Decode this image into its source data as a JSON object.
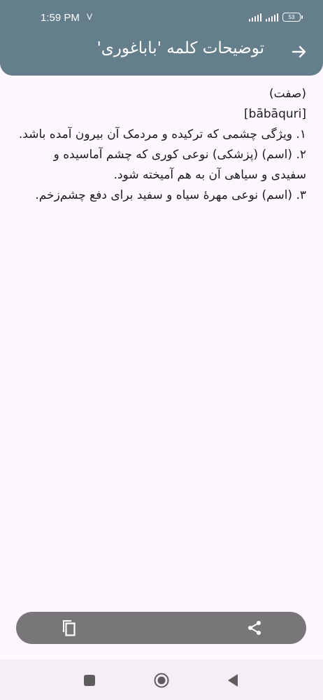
{
  "status_bar": {
    "time": "1:59 PM",
    "indicator": "V",
    "battery": "53",
    "icons": [
      "signal-icon",
      "signal-icon",
      "battery-icon"
    ]
  },
  "header": {
    "title": "توضیحات کلمه 'باباغوری'",
    "back_icon": "arrow-right-icon",
    "background": "#657e8b"
  },
  "definition": {
    "part_of_speech": "(صفت)",
    "pronunciation": "[bābāquri]",
    "senses": [
      "۱. ویژگی چشمی که ترکیده و مردمک آن بیرون آمده باشد.",
      "۲. (اسم) (پزشکی) نوعی کوری که چشم آماسیده و سفیدی و سیاهی آن به هم آمیخته شود.",
      "۳. (اسم) نوعی مهرهٔ سیاه و سفید برای دفع چشم‌زخم."
    ]
  },
  "action_bar": {
    "copy_icon": "copy-icon",
    "share_icon": "share-icon",
    "background": "#79767a"
  },
  "nav_bar": {
    "icons": [
      "recents-square-icon",
      "home-circle-icon",
      "back-triangle-icon"
    ]
  }
}
